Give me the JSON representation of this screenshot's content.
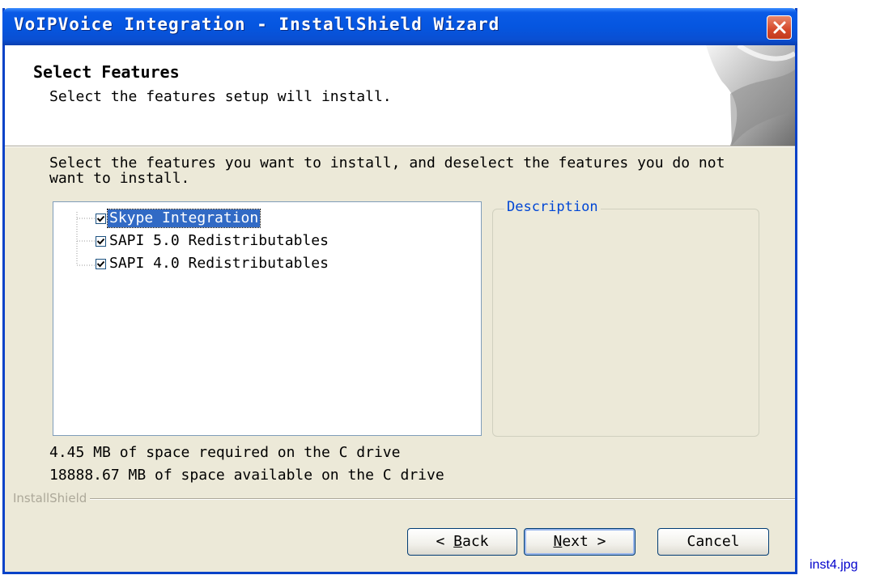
{
  "window": {
    "title": "VoIPVoice Integration - InstallShield Wizard",
    "close_icon": "close-icon"
  },
  "header": {
    "title": "Select Features",
    "subtitle": "Select the features setup will install."
  },
  "instructions": "Select the features you want to install, and deselect the features you do not want to install.",
  "features": [
    {
      "label": "Skype Integration",
      "checked": true,
      "selected": true
    },
    {
      "label": "SAPI 5.0 Redistributables",
      "checked": true,
      "selected": false
    },
    {
      "label": "SAPI 4.0 Redistributables",
      "checked": true,
      "selected": false
    }
  ],
  "description": {
    "legend": "Description",
    "text": ""
  },
  "space": {
    "required": "4.45 MB of space required on the C drive",
    "available": "18888.67 MB of space available on the C drive"
  },
  "brand_label": "InstallShield",
  "buttons": {
    "back": {
      "prefix": "< ",
      "accel": "B",
      "rest": "ack"
    },
    "next": {
      "accel": "N",
      "rest": "ext >"
    },
    "cancel": "Cancel"
  },
  "filename": "inst4.jpg",
  "colors": {
    "titlebar": "#0556e0",
    "dialog_bg": "#ece9d8",
    "selection": "#316ac5",
    "legend_text": "#0046d5",
    "filename_link": "#0000cc"
  }
}
